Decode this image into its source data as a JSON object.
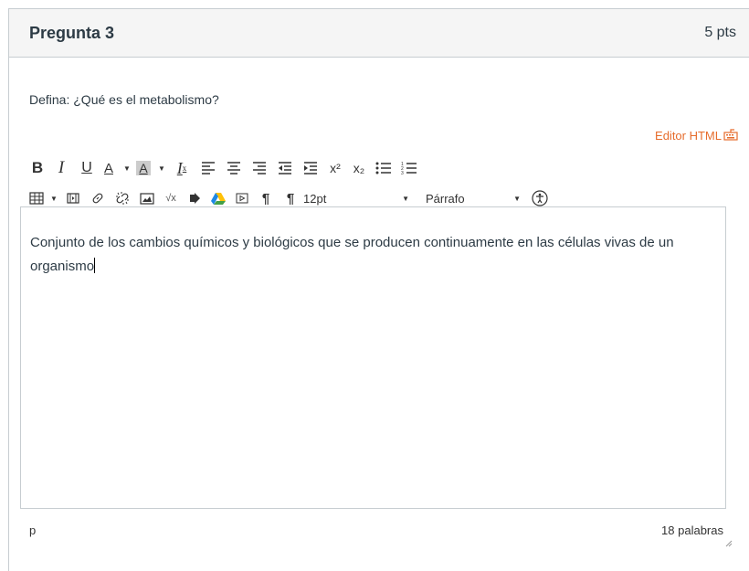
{
  "question": {
    "title": "Pregunta 3",
    "points": "5 pts",
    "prompt": "Defina: ¿Qué es el metabolismo?"
  },
  "editor": {
    "html_editor_link": "Editor HTML",
    "font_size": "12pt",
    "block_format": "Párrafo",
    "content": "Conjunto de los cambios químicos y biológicos que se producen continuamente en las células vivas de un organismo",
    "status_path": "p",
    "word_count": "18 palabras"
  },
  "toolbar": {
    "bold_label": "B",
    "italic_label": "I",
    "underline_label": "U",
    "font_color_label": "A",
    "bg_color_label": "A",
    "clear_format_label": "I",
    "superscript_label": "x²",
    "subscript_label": "x₂"
  },
  "colors": {
    "accent_orange": "#e66c2c",
    "header_bg": "#f5f5f5",
    "border": "#c7cdd1",
    "text": "#2d3b45"
  }
}
